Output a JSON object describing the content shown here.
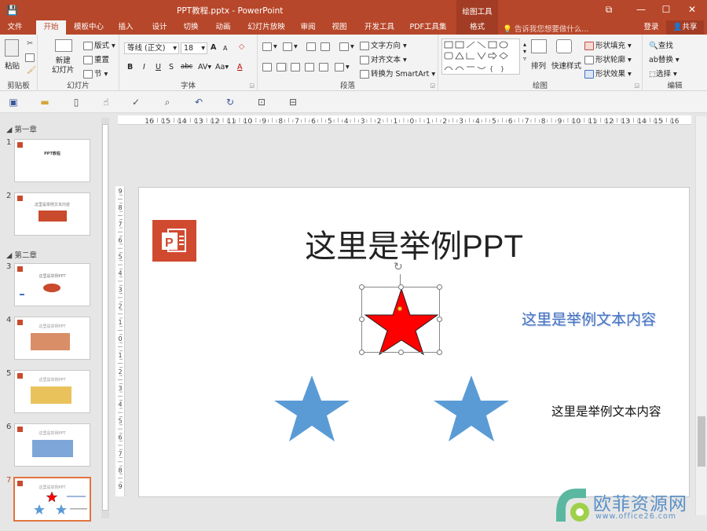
{
  "window": {
    "title": "PPT教程.pptx - PowerPoint",
    "context_header": "绘图工具",
    "controls": [
      "⧉",
      "—",
      "☐",
      "✕"
    ]
  },
  "tabs": [
    {
      "label": "文件"
    },
    {
      "label": "开始"
    },
    {
      "label": "模板中心"
    },
    {
      "label": "插入"
    },
    {
      "label": "设计"
    },
    {
      "label": "切换"
    },
    {
      "label": "动画"
    },
    {
      "label": "幻灯片放映"
    },
    {
      "label": "审阅"
    },
    {
      "label": "视图"
    },
    {
      "label": "开发工具"
    },
    {
      "label": "PDF工具集"
    },
    {
      "label": "格式"
    }
  ],
  "tellme": "告诉我您想要做什么...",
  "account": {
    "login": "登录",
    "share": "共享"
  },
  "ribbon": {
    "clipboard": {
      "label": "剪贴板",
      "paste": "粘贴"
    },
    "slides": {
      "label": "幻灯片",
      "new_slide": "新建\n幻灯片",
      "layout": "版式",
      "reset": "重置",
      "section": "节"
    },
    "font": {
      "label": "字体",
      "font_name": "等线 (正文)",
      "font_size": "18",
      "bold": "B",
      "italic": "I",
      "underline": "U",
      "shadow": "S",
      "strike": "abc",
      "spacing": "AV",
      "case": "Aa",
      "color": "A",
      "grow": "A",
      "shrink": "A"
    },
    "paragraph": {
      "label": "段落",
      "text_direction": "文字方向",
      "align_text": "对齐文本",
      "smartart": "转换为 SmartArt"
    },
    "drawing": {
      "label": "绘图",
      "arrange": "排列",
      "quick_styles": "快速样式",
      "shape_fill": "形状填充",
      "shape_outline": "形状轮廓",
      "shape_effects": "形状效果"
    },
    "editing": {
      "label": "编辑",
      "find": "查找",
      "replace": "替换",
      "select": "选择"
    }
  },
  "thumbnails": {
    "section1": "第一章",
    "section2": "第二章",
    "slides": [
      {
        "num": "1",
        "title": "PPT教程"
      },
      {
        "num": "2",
        "title": "这里是举例文本内容"
      },
      {
        "num": "3",
        "title": "这里是举例PPT"
      },
      {
        "num": "4",
        "title": "这里是举例PPT"
      },
      {
        "num": "5",
        "title": "这里是举例PPT"
      },
      {
        "num": "6",
        "title": "这里是举例PPT"
      },
      {
        "num": "7",
        "title": "这里是举例PPT"
      }
    ]
  },
  "ruler": {
    "h_ticks": [
      "16",
      "15",
      "14",
      "13",
      "12",
      "11",
      "10",
      "9",
      "8",
      "7",
      "6",
      "5",
      "4",
      "3",
      "2",
      "1",
      "0",
      "1",
      "2",
      "3",
      "4",
      "5",
      "6",
      "7",
      "8",
      "9",
      "10",
      "11",
      "12",
      "13",
      "14",
      "15",
      "16"
    ],
    "v_ticks": [
      "9",
      "8",
      "7",
      "6",
      "5",
      "4",
      "3",
      "2",
      "1",
      "0",
      "1",
      "2",
      "3",
      "4",
      "5",
      "6",
      "7",
      "8",
      "9"
    ]
  },
  "slide": {
    "title": "这里是举例PPT",
    "text_blue": "这里是举例文本内容",
    "text_black": "这里是举例文本内容"
  },
  "watermark": {
    "name": "欧菲资源网",
    "url": "www.office26.com"
  },
  "colors": {
    "accent": "#b7472a",
    "star_red": "#ff0000",
    "star_blue": "#5b9bd5",
    "text_blue": "#4472c4"
  }
}
